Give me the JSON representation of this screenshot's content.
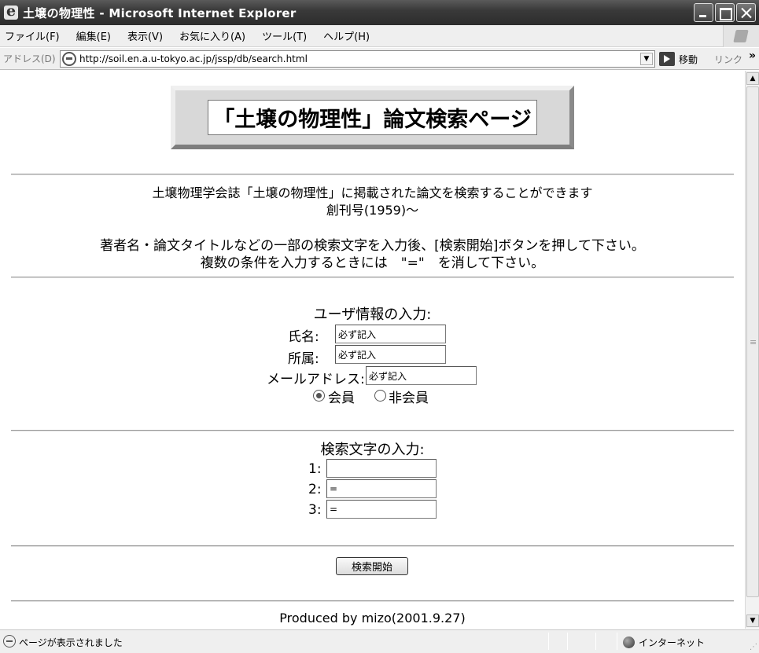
{
  "window": {
    "title": "土壌の物理性 - Microsoft Internet Explorer"
  },
  "menu": {
    "items": [
      "ファイル(F)",
      "編集(E)",
      "表示(V)",
      "お気に入り(A)",
      "ツール(T)",
      "ヘルプ(H)"
    ]
  },
  "address_bar": {
    "label": "アドレス(D)",
    "url": "http://soil.en.a.u-tokyo.ac.jp/jssp/db/search.html",
    "go_label": "移動",
    "links_label": "リンク",
    "links_chevron": "»"
  },
  "page": {
    "heading": "「土壌の物理性」論文検索ページ",
    "intro": {
      "line1": "土壌物理学会誌「土壌の物理性」に掲載された論文を検索することができます",
      "line2": "創刊号(1959)～",
      "line3": "著者名・論文タイトルなどの一部の検索文字を入力後、[検索開始]ボタンを押して下さい。",
      "line4": "複数の条件を入力するときには　\"=\"　を消して下さい。"
    },
    "user_section": {
      "title": "ユーザ情報の入力:",
      "name_label": "氏名:",
      "name_value": "必ず記入",
      "affiliation_label": "所属:",
      "affiliation_value": "必ず記入",
      "email_label": "メールアドレス:",
      "email_value": "必ず記入",
      "member_label": "会員",
      "nonmember_label": "非会員",
      "member_selected": true
    },
    "search_section": {
      "title": "検索文字の入力:",
      "field1_label": "1:",
      "field1_value": "",
      "field2_label": "2:",
      "field2_value": "=",
      "field3_label": "3:",
      "field3_value": "="
    },
    "submit_label": "検索開始",
    "footer": "Produced by mizo(2001.9.27)"
  },
  "status_bar": {
    "text": "ページが表示されました",
    "zone": "インターネット"
  },
  "icons": {
    "app": "ie-logo-icon",
    "page": "ie-page-icon",
    "go": "go-arrow-icon",
    "zone": "internet-globe-icon"
  }
}
